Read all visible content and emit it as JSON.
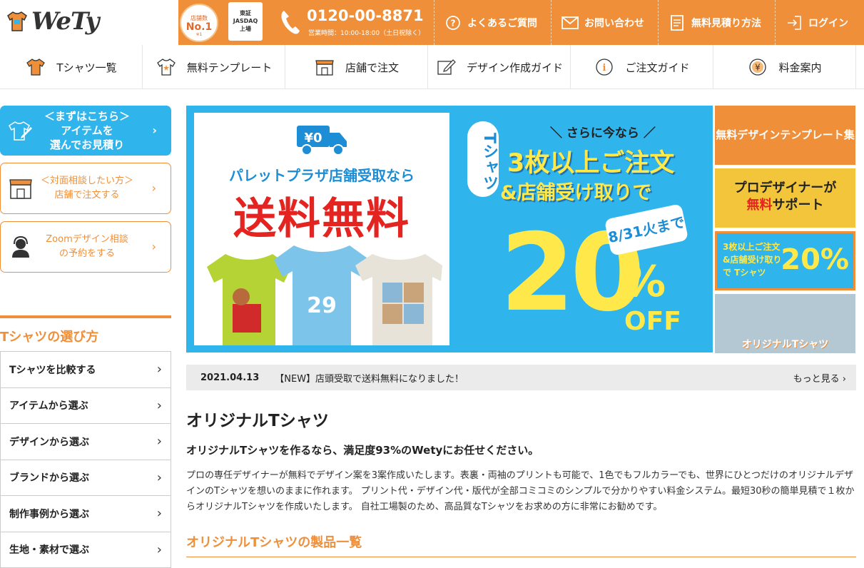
{
  "header": {
    "logo_text": "WeTy",
    "badge_top": "店舗数",
    "badge_main": "No.1",
    "badge_note": "※1",
    "listing_line1": "東証",
    "listing_line2": "JASDAQ",
    "listing_line3": "上場",
    "phone": "0120-00-8871",
    "hours": "営業時間：10:00-18:00（土日祝除く）",
    "links": [
      {
        "label": "よくあるご質問",
        "icon": "question-circle-icon"
      },
      {
        "label": "お問い合わせ",
        "icon": "envelope-icon"
      },
      {
        "label": "無料見積り方法",
        "icon": "document-icon"
      },
      {
        "label": "ログイン",
        "icon": "login-icon"
      }
    ]
  },
  "nav": [
    {
      "label": "Tシャツ一覧",
      "icon": "tshirt-icon"
    },
    {
      "label": "無料テンプレート",
      "icon": "template-shirt-icon"
    },
    {
      "label": "店舗で注文",
      "icon": "store-icon"
    },
    {
      "label": "デザイン作成ガイド",
      "icon": "pencil-edit-icon"
    },
    {
      "label": "ご注文ガイド",
      "icon": "info-icon"
    },
    {
      "label": "料金案内",
      "icon": "yen-coin-icon"
    }
  ],
  "side": {
    "btn1": {
      "line1": "＜まずはこちら＞",
      "line2": "アイテムを",
      "line3": "選んでお見積り"
    },
    "btn2": {
      "line1": "＜対面相談したい方＞",
      "line2": "店舗で注文する"
    },
    "btn3": {
      "line1": "Zoomデザイン相談",
      "line2": "の予約をする"
    },
    "section_title": "Tシャツの選び方",
    "items": [
      "Tシャツを比較する",
      "アイテムから選ぶ",
      "デザインから選ぶ",
      "ブランドから選ぶ",
      "制作事例から選ぶ",
      "生地・素材で選ぶ"
    ]
  },
  "hero": {
    "truck_price": "¥0",
    "left_line1": "パレットプラザ店舗受取なら",
    "left_line2": "送料無料",
    "tag": "Tシャツ",
    "right_line1": "＼ さらに今なら ／",
    "right_line2": "3枚以上ご注文",
    "right_line3": "&店舗受け取りで",
    "deadline": "8/31火まで",
    "discount_num": "20",
    "discount_pct": "%",
    "discount_off": "OFF"
  },
  "thumbs": [
    "無料デザインテンプレート集",
    "プロデザイナーが",
    "無料",
    "サポート",
    "3枚以上ご注文 &店舗受け取りで Tシャツ",
    "20%",
    "オリジナルTシャツ"
  ],
  "news": {
    "date": "2021.04.13",
    "text": "【NEW】店頭受取で送料無料になりました！",
    "more": "もっと見る"
  },
  "main": {
    "title": "オリジナルTシャツ",
    "lead": "オリジナルTシャツを作るなら、満足度93%のWetyにお任せください。",
    "body": "プロの専任デザイナーが無料でデザイン案を3案作成いたします。表裏・両袖のプリントも可能で、1色でもフルカラーでも、世界にひとつだけのオリジナルデザインのTシャツを想いのままに作れます。 プリント代・デザイン代・版代が全部コミコミのシンプルで分かりやすい料金システム。最短30秒の簡単見積で１枚からオリジナルTシャツを作成いたします。 自社工場製のため、高品質なTシャツをお求めの方に非常にお勧めです。",
    "products_title": "オリジナルTシャツの製品一覧"
  },
  "colors": {
    "accent": "#ef8f3a",
    "blue": "#2fb4ec",
    "yellow": "#ffe94a",
    "red": "#e32420"
  }
}
